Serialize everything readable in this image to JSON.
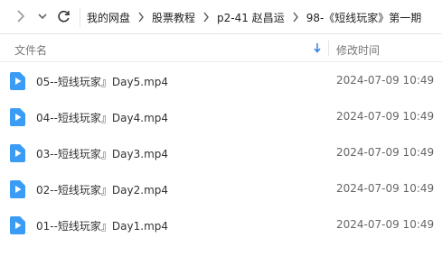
{
  "breadcrumb": {
    "items": [
      "我的网盘",
      "股票教程",
      "p2-41 赵昌运",
      "98-《短线玩家》第一期"
    ]
  },
  "header": {
    "name_label": "文件名",
    "time_label": "修改时间"
  },
  "files": [
    {
      "name": "05--短线玩家』Day5.mp4",
      "modified": "2024-07-09 10:49",
      "icon": "video-file-icon"
    },
    {
      "name": "04--短线玩家』Day4.mp4",
      "modified": "2024-07-09 10:49",
      "icon": "video-file-icon"
    },
    {
      "name": "03--短线玩家』Day3.mp4",
      "modified": "2024-07-09 10:49",
      "icon": "video-file-icon"
    },
    {
      "name": "02--短线玩家』Day2.mp4",
      "modified": "2024-07-09 10:49",
      "icon": "video-file-icon"
    },
    {
      "name": "01--短线玩家』Day1.mp4",
      "modified": "2024-07-09 10:49",
      "icon": "video-file-icon"
    }
  ],
  "colors": {
    "accent": "#2f80ed",
    "file_icon": "#3b9cf5"
  }
}
